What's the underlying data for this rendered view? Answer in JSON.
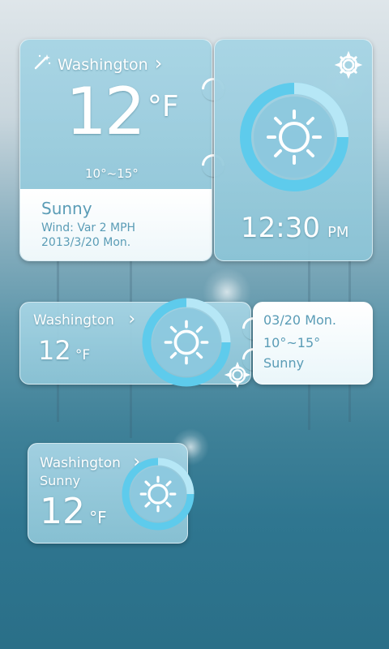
{
  "widget_large": {
    "city": "Washington",
    "city_arrow": "›",
    "temp": "12",
    "unit": "°F",
    "range": "10°~15°",
    "condition": "Sunny",
    "wind": "Wind: Var 2 MPH",
    "date": "2013/3/20 Mon.",
    "time": "12:30",
    "ampm": "PM"
  },
  "widget_medium": {
    "city": "Washington",
    "city_arrow": "›",
    "temp": "12",
    "unit": "°F",
    "date": "03/20 Mon.",
    "range": "10°~15°",
    "condition": "Sunny"
  },
  "widget_small": {
    "city": "Washington",
    "city_arrow": "›",
    "condition": "Sunny",
    "temp": "12",
    "unit": "°F"
  },
  "colors": {
    "accent": "#5ecbec",
    "glass": "#a6d4e4"
  },
  "icons": [
    "magic-wand-icon",
    "gear-icon",
    "sun-icon"
  ]
}
